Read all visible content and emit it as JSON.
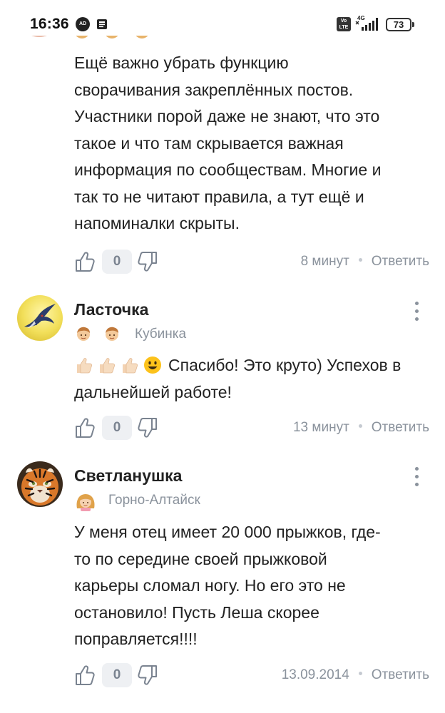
{
  "status_bar": {
    "time": "16:36",
    "ad_icon_label": "AD",
    "volte_label": "Vo LTE",
    "network": "4G",
    "battery": "73"
  },
  "comments": [
    {
      "text": "Ещё важно убрать функцию\nсворачивания закреплённых постов.\nУчастники порой даже не знают, что это\nтакое и что там скрывается важная\nинформация по сообществам. Многие и\nтак то не читают правила, а тут ещё и\nнапоминалки скрыты.",
      "score": "0",
      "time": "8 минут",
      "reply_label": "Ответить"
    },
    {
      "author": "Ласточка",
      "city": "Кубинка",
      "emoji_text": "👍🏻👍🏻👍🏻😃",
      "text_line1": "Спасибо! Это круто) Успехов в",
      "text_line2": "дальнейшей работе!",
      "score": "0",
      "time": "13 минут",
      "reply_label": "Ответить"
    },
    {
      "author": "Светланушка",
      "city": "Горно-Алтайск",
      "text": "У меня отец имеет 20 000 прыжков, где-\nто по середине своей прыжковой\nкарьеры сломал ногу. Но его это не\nостановило! Пусть Леша скорее\nпоправляется!!!!",
      "score": "0",
      "time": "13.09.2014",
      "reply_label": "Ответить"
    }
  ],
  "colors": {
    "text": "#222222",
    "meta": "#8a929c",
    "score_bg": "#eef0f3"
  },
  "icons": {
    "like": "thumb-up-outline-icon",
    "dislike": "thumb-down-outline-icon",
    "more": "vertical-dots-icon"
  }
}
